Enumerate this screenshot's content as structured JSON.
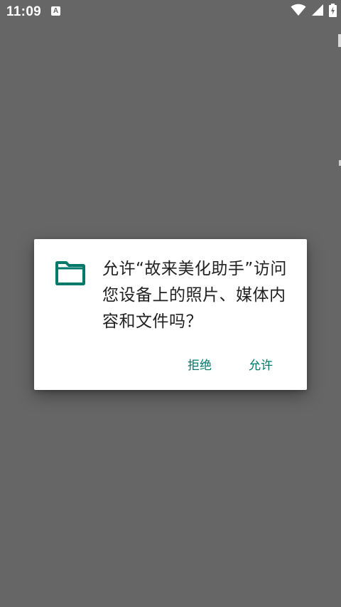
{
  "status_bar": {
    "time": "11:09",
    "notification_icon": "A",
    "icons": [
      "wifi-icon",
      "signal-icon",
      "battery-charging-icon"
    ]
  },
  "dialog": {
    "icon": "folder-icon",
    "message": "允许“故来美化助手”访问您设备上的照片、媒体内容和文件吗？",
    "deny_label": "拒绝",
    "allow_label": "允许"
  },
  "colors": {
    "scrim": "#666666",
    "accent": "#00796b",
    "dialog_bg": "#ffffff",
    "text": "#212121"
  }
}
